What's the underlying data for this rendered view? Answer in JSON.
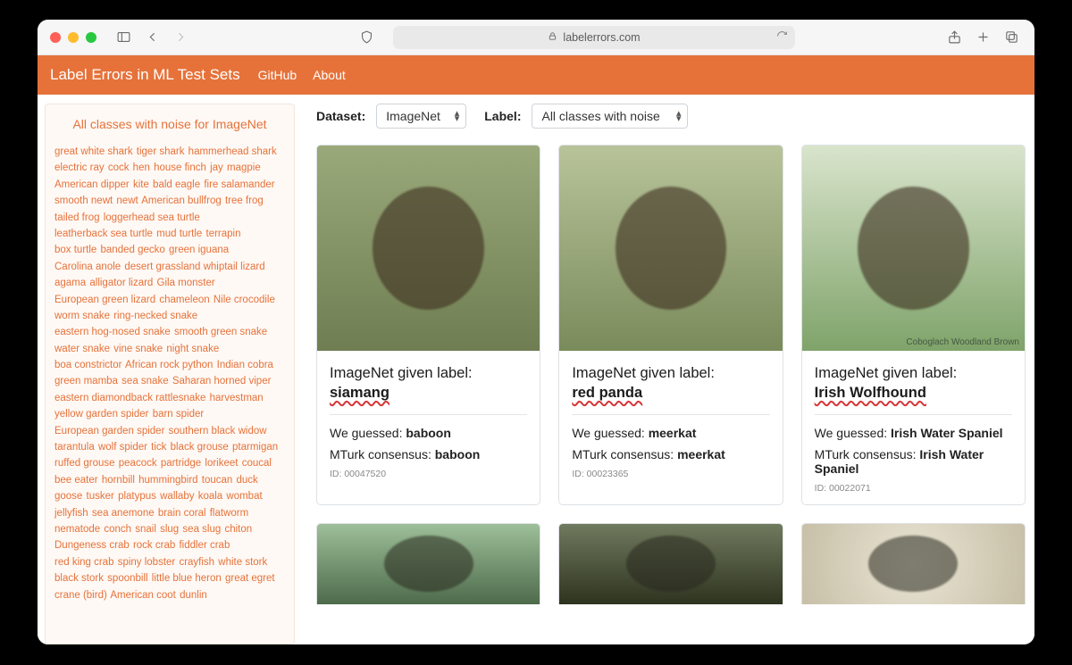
{
  "browser": {
    "url_host": "labelerrors.com"
  },
  "header": {
    "title": "Label Errors in ML Test Sets",
    "nav": [
      "GitHub",
      "About"
    ]
  },
  "controls": {
    "dataset_label": "Dataset:",
    "dataset_value": "ImageNet",
    "label_label": "Label:",
    "label_value": "All classes with noise"
  },
  "sidebar": {
    "title": "All classes with noise for ImageNet",
    "tags": [
      "great white shark",
      "tiger shark",
      "hammerhead shark",
      "electric ray",
      "cock",
      "hen",
      "house finch",
      "jay",
      "magpie",
      "American dipper",
      "kite",
      "bald eagle",
      "fire salamander",
      "smooth newt",
      "newt",
      "American bullfrog",
      "tree frog",
      "tailed frog",
      "loggerhead sea turtle",
      "leatherback sea turtle",
      "mud turtle",
      "terrapin",
      "box turtle",
      "banded gecko",
      "green iguana",
      "Carolina anole",
      "desert grassland whiptail lizard",
      "agama",
      "alligator lizard",
      "Gila monster",
      "European green lizard",
      "chameleon",
      "Nile crocodile",
      "worm snake",
      "ring-necked snake",
      "eastern hog-nosed snake",
      "smooth green snake",
      "water snake",
      "vine snake",
      "night snake",
      "boa constrictor",
      "African rock python",
      "Indian cobra",
      "green mamba",
      "sea snake",
      "Saharan horned viper",
      "eastern diamondback rattlesnake",
      "harvestman",
      "yellow garden spider",
      "barn spider",
      "European garden spider",
      "southern black widow",
      "tarantula",
      "wolf spider",
      "tick",
      "black grouse",
      "ptarmigan",
      "ruffed grouse",
      "peacock",
      "partridge",
      "lorikeet",
      "coucal",
      "bee eater",
      "hornbill",
      "hummingbird",
      "toucan",
      "duck",
      "goose",
      "tusker",
      "platypus",
      "wallaby",
      "koala",
      "wombat",
      "jellyfish",
      "sea anemone",
      "brain coral",
      "flatworm",
      "nematode",
      "conch",
      "snail",
      "slug",
      "sea slug",
      "chiton",
      "Dungeness crab",
      "rock crab",
      "fiddler crab",
      "red king crab",
      "spiny lobster",
      "crayfish",
      "white stork",
      "black stork",
      "spoonbill",
      "little blue heron",
      "great egret",
      "crane (bird)",
      "American coot",
      "dunlin"
    ]
  },
  "cards": [
    {
      "given_prefix": "ImageNet given label:",
      "given": "siamang",
      "guess_label": "We guessed:",
      "guess": "baboon",
      "mturk_label": "MTurk consensus:",
      "mturk": "baboon",
      "id_label": "ID:",
      "id": "00047520",
      "img_class": "ph-olive"
    },
    {
      "given_prefix": "ImageNet given label:",
      "given": "red panda",
      "guess_label": "We guessed:",
      "guess": "meerkat",
      "mturk_label": "MTurk consensus:",
      "mturk": "meerkat",
      "id_label": "ID:",
      "id": "00023365",
      "img_class": "ph-grass",
      "watermark": ""
    },
    {
      "given_prefix": "ImageNet given label:",
      "given": "Irish Wolfhound",
      "guess_label": "We guessed:",
      "guess": "Irish Water Spaniel",
      "mturk_label": "MTurk consensus:",
      "mturk": "Irish Water Spaniel",
      "id_label": "ID:",
      "id": "00022071",
      "img_class": "ph-lawn",
      "watermark": "Coboglach Woodland Brown"
    }
  ],
  "row2_img_classes": [
    "ph-forest",
    "ph-dark",
    "ph-gravel"
  ]
}
